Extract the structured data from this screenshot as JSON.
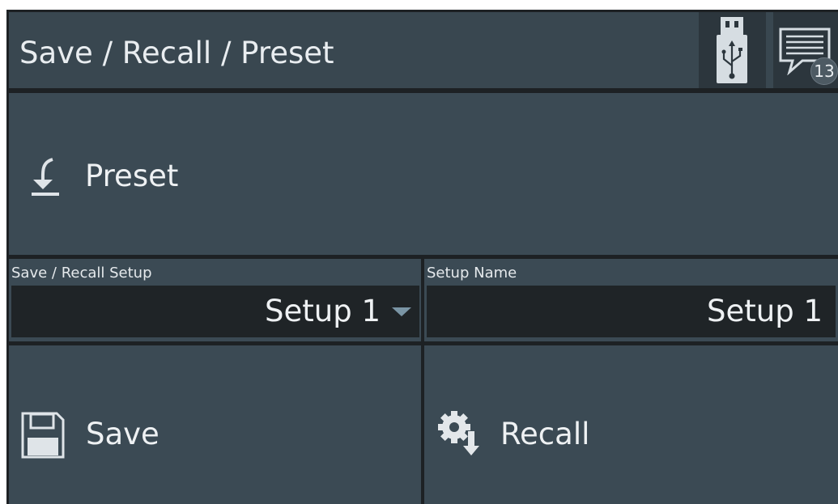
{
  "header": {
    "title": "Save / Recall / Preset",
    "usb_icon": "usb-drive-icon",
    "message_icon": "message-icon",
    "message_count": "13"
  },
  "preset": {
    "label": "Preset",
    "icon": "preset-arrow-icon"
  },
  "save_recall_setup": {
    "label": "Save / Recall Setup",
    "value": "Setup 1"
  },
  "setup_name": {
    "label": "Setup Name",
    "value": "Setup 1"
  },
  "actions": {
    "save_label": "Save",
    "save_icon": "floppy-disk-icon",
    "recall_label": "Recall",
    "recall_icon": "gear-download-icon"
  },
  "colors": {
    "tile_background": "#3b4a54",
    "header_background": "#394750",
    "frame_background": "#1d2124",
    "field_background": "#1f2427",
    "dropdown_arrow": "#7a95a5"
  }
}
